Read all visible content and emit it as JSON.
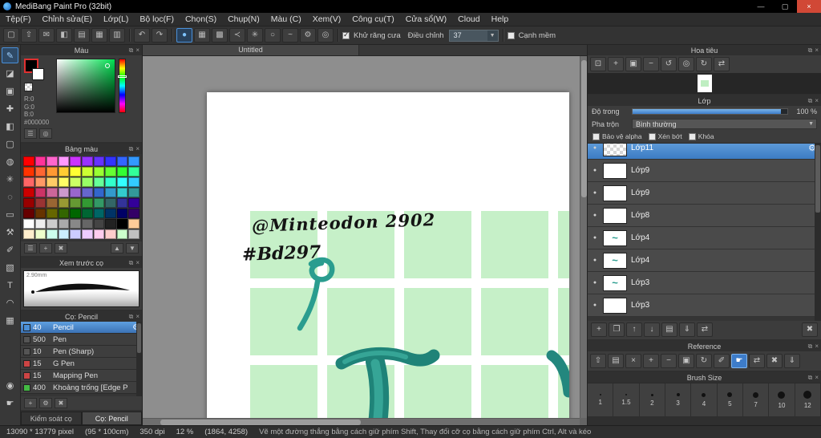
{
  "window": {
    "title": "MediBang Paint Pro (32bit)"
  },
  "titlebar_controls": {
    "minimize": "—",
    "maximize": "▢",
    "close": "×"
  },
  "menu": {
    "items": [
      {
        "key": "file",
        "label": "Tệp(F)"
      },
      {
        "key": "edit",
        "label": "Chỉnh sửa(E)"
      },
      {
        "key": "layer",
        "label": "Lớp(L)"
      },
      {
        "key": "filter",
        "label": "Bộ lọc(F)"
      },
      {
        "key": "select",
        "label": "Chọn(S)"
      },
      {
        "key": "snap",
        "label": "Chụp(N)"
      },
      {
        "key": "color",
        "label": "Màu (C)"
      },
      {
        "key": "view",
        "label": "Xem(V)"
      },
      {
        "key": "tool",
        "label": "Công cụ(T)"
      },
      {
        "key": "window",
        "label": "Cửa sổ(W)"
      },
      {
        "key": "cloud",
        "label": "Cloud"
      },
      {
        "key": "help",
        "label": "Help"
      }
    ]
  },
  "toolbar": {
    "file_icons": [
      {
        "name": "new-file-icon",
        "glyph": "▢"
      },
      {
        "name": "export-icon",
        "glyph": "⇧"
      },
      {
        "name": "comment-icon",
        "glyph": "✉"
      },
      {
        "name": "material-icon",
        "glyph": "◧"
      },
      {
        "name": "document-icon",
        "glyph": "▤"
      },
      {
        "name": "pixel-grid-icon",
        "glyph": "▦"
      },
      {
        "name": "table-icon",
        "glyph": "▥"
      }
    ],
    "history_icons": [
      {
        "name": "undo-icon",
        "glyph": "↶"
      },
      {
        "name": "redo-icon",
        "glyph": "↷"
      }
    ],
    "brush_option_icons": [
      {
        "name": "brush-tip-icon",
        "glyph": "●",
        "active": true
      },
      {
        "name": "pattern-icon",
        "glyph": "▦"
      },
      {
        "name": "mesh-icon",
        "glyph": "▩"
      },
      {
        "name": "snap-angle-icon",
        "glyph": "≺"
      },
      {
        "name": "snap-radial-icon",
        "glyph": "✳"
      },
      {
        "name": "snap-circle-icon",
        "glyph": "○"
      },
      {
        "name": "snap-curve-icon",
        "glyph": "~"
      },
      {
        "name": "snap-settings-icon",
        "glyph": "⚙"
      },
      {
        "name": "crosshair-icon",
        "glyph": "◎"
      }
    ],
    "antialias": {
      "label": "Khử răng cưa",
      "checked": true
    },
    "adjust": {
      "label": "Điều chỉnh",
      "value": "37"
    },
    "soft_edge": {
      "label": "Cạnh mềm",
      "checked": false
    }
  },
  "tools": {
    "items": [
      {
        "name": "brush-tool",
        "glyph": "✎",
        "active": true
      },
      {
        "name": "eraser-tool",
        "glyph": "◪"
      },
      {
        "name": "dot-tool",
        "glyph": "▣"
      },
      {
        "name": "move-tool",
        "glyph": "✚"
      },
      {
        "name": "fill-tool",
        "glyph": "◧"
      },
      {
        "name": "select-tool",
        "glyph": "▢"
      },
      {
        "name": "bucket-tool",
        "glyph": "◍"
      },
      {
        "name": "magic-wand-tool",
        "glyph": "✳"
      },
      {
        "name": "ellipse-select-tool",
        "glyph": "◌"
      },
      {
        "name": "rect-select-tool",
        "glyph": "▭"
      },
      {
        "name": "operation-tool",
        "glyph": "⚒"
      },
      {
        "name": "select-pen-tool",
        "glyph": "✐"
      },
      {
        "name": "gradient-tool",
        "glyph": "▧"
      },
      {
        "name": "text-tool",
        "glyph": "T"
      },
      {
        "name": "lasso-tool",
        "glyph": "◠"
      },
      {
        "name": "frame-divide-tool",
        "glyph": "▦"
      }
    ],
    "bottom": [
      {
        "name": "eyedropper-tool",
        "glyph": "◉"
      },
      {
        "name": "hand-tool",
        "glyph": "☛"
      }
    ]
  },
  "panels": {
    "color": {
      "title": "Màu",
      "r": "R:0",
      "g": "G:0",
      "b": "B:0",
      "hex": "#000000",
      "bottom_icons": [
        {
          "name": "color-sliders-icon",
          "glyph": "☰"
        },
        {
          "name": "color-wheel-icon",
          "glyph": "◎"
        }
      ]
    },
    "palette": {
      "title": "Bảng màu",
      "colors": [
        "#ff0000",
        "#ff3399",
        "#ff66cc",
        "#ff99ff",
        "#cc33ff",
        "#9933ff",
        "#6633ff",
        "#3333ff",
        "#3366ff",
        "#3399ff",
        "#ff3300",
        "#ff6633",
        "#ff9933",
        "#ffcc33",
        "#ffff33",
        "#ccff33",
        "#99ff33",
        "#66ff33",
        "#33ff33",
        "#33ff99",
        "#ff6666",
        "#ff9966",
        "#ffcc66",
        "#ffff66",
        "#ccff66",
        "#99ff66",
        "#66ff99",
        "#33ffcc",
        "#33ffff",
        "#33ccff",
        "#cc0000",
        "#cc3366",
        "#cc6699",
        "#cc99cc",
        "#9966cc",
        "#6666cc",
        "#3366cc",
        "#3399cc",
        "#33cccc",
        "#339999",
        "#990000",
        "#993333",
        "#996633",
        "#999933",
        "#669933",
        "#339933",
        "#339966",
        "#336666",
        "#333399",
        "#330099",
        "#660000",
        "#663300",
        "#666600",
        "#336600",
        "#006600",
        "#006633",
        "#006666",
        "#003366",
        "#000066",
        "#330066",
        "#ffffff",
        "#eeeeee",
        "#cccccc",
        "#aaaaaa",
        "#888888",
        "#666666",
        "#444444",
        "#222222",
        "#000000",
        "#ffcc99",
        "#ffeecc",
        "#eeffcc",
        "#ccffee",
        "#cceeff",
        "#ccccff",
        "#eeccff",
        "#ffccee",
        "#ffcccc",
        "#ccffcc",
        "#c0c0c0"
      ],
      "buttons": [
        {
          "name": "palette-list-icon",
          "glyph": "☰"
        },
        {
          "name": "add-color-icon",
          "glyph": "+"
        },
        {
          "name": "delete-color-icon",
          "glyph": "✖"
        }
      ],
      "sort_buttons": [
        {
          "name": "move-color-up-icon",
          "glyph": "▲"
        },
        {
          "name": "move-color-down-icon",
          "glyph": "▼"
        }
      ]
    },
    "preview": {
      "title": "Xem trước cọ",
      "size_label": "2.90mm"
    },
    "brushes": {
      "title": "Cọ: Pencil",
      "items": [
        {
          "size": "40",
          "name": "Pencil",
          "chip": "#4a90d9",
          "selected": true
        },
        {
          "size": "500",
          "name": "Pen",
          "chip": "#555555"
        },
        {
          "size": "10",
          "name": "Pen (Sharp)",
          "chip": "#555555"
        },
        {
          "size": "15",
          "name": "G Pen",
          "chip": "#cc4444"
        },
        {
          "size": "15",
          "name": "Mapping Pen",
          "chip": "#cc4444"
        },
        {
          "size": "400",
          "name": "Khoảng trống [Edge P",
          "chip": "#44bb44"
        }
      ],
      "buttons": [
        {
          "name": "add-brush-icon",
          "glyph": "+"
        },
        {
          "name": "brush-settings-icon",
          "glyph": "⚙"
        },
        {
          "name": "delete-brush-icon",
          "glyph": "✖"
        }
      ],
      "tabs": [
        "Kiểm soát cọ",
        "Cọ: Pencil"
      ]
    },
    "navigator": {
      "title": "Hoa tiêu",
      "icons": [
        {
          "name": "fit-view-icon",
          "glyph": "⊡"
        },
        {
          "name": "zoom-in-icon",
          "glyph": "+"
        },
        {
          "name": "zoom-panel-icon",
          "glyph": "▣"
        },
        {
          "name": "zoom-out-icon",
          "glyph": "−"
        },
        {
          "name": "rotate-left-icon",
          "glyph": "↺"
        },
        {
          "name": "reset-view-icon",
          "glyph": "◎"
        },
        {
          "name": "rotate-right-icon",
          "glyph": "↻"
        },
        {
          "name": "flip-view-icon",
          "glyph": "⇄"
        }
      ]
    },
    "layers": {
      "title": "Lớp",
      "opacity_label": "Độ trong",
      "opacity_value": "100 %",
      "blend_label": "Pha trộn",
      "blend_value": "Bình thường",
      "checkboxes": [
        "Bảo vệ alpha",
        "Xén bớt",
        "Khóa"
      ],
      "items": [
        {
          "name": "Lớp11",
          "selected": true,
          "thumb": "checker"
        },
        {
          "name": "Lớp9",
          "thumb": "plain"
        },
        {
          "name": "Lớp9",
          "thumb": "plain"
        },
        {
          "name": "Lớp8",
          "thumb": "plain"
        },
        {
          "name": "Lớp4",
          "thumb": "teal"
        },
        {
          "name": "Lớp4",
          "thumb": "teal"
        },
        {
          "name": "Lớp3",
          "thumb": "teal"
        },
        {
          "name": "Lớp3",
          "thumb": "plain"
        }
      ],
      "toolbar_icons": [
        {
          "name": "add-layer-icon",
          "glyph": "+"
        },
        {
          "name": "duplicate-layer-icon",
          "glyph": "❐"
        },
        {
          "name": "layer-up-icon",
          "glyph": "↑"
        },
        {
          "name": "layer-down-icon",
          "glyph": "↓"
        },
        {
          "name": "new-folder-icon",
          "glyph": "▤"
        },
        {
          "name": "merge-down-icon",
          "glyph": "⇓"
        },
        {
          "name": "transfer-layer-icon",
          "glyph": "⇄"
        }
      ],
      "delete_icon": {
        "name": "delete-layer-icon",
        "glyph": "✖"
      }
    },
    "reference": {
      "title": "Reference",
      "icons": [
        {
          "name": "open-reference-icon",
          "glyph": "⇧"
        },
        {
          "name": "folder-icon",
          "glyph": "▤"
        },
        {
          "name": "close-reference-icon",
          "glyph": "×"
        },
        {
          "name": "zoom-in-icon",
          "glyph": "+"
        },
        {
          "name": "zoom-out-icon",
          "glyph": "−"
        },
        {
          "name": "actual-size-icon",
          "glyph": "▣"
        },
        {
          "name": "rotate-icon",
          "glyph": "↻"
        },
        {
          "name": "eyedropper-icon",
          "glyph": "✐"
        },
        {
          "name": "hand-icon",
          "glyph": "☛",
          "active": true
        },
        {
          "name": "flip-icon",
          "glyph": "⇄"
        },
        {
          "name": "clear-icon",
          "glyph": "✖"
        },
        {
          "name": "save-icon",
          "glyph": "⇓"
        }
      ]
    },
    "brush_size": {
      "title": "Brush Size",
      "sizes": [
        {
          "label": "1",
          "dot": 2
        },
        {
          "label": "1.5",
          "dot": 2
        },
        {
          "label": "2",
          "dot": 3
        },
        {
          "label": "3",
          "dot": 4
        },
        {
          "label": "4",
          "dot": 5
        },
        {
          "label": "5",
          "dot": 6
        },
        {
          "label": "7",
          "dot": 7
        },
        {
          "label": "10",
          "dot": 9
        },
        {
          "label": "12",
          "dot": 10
        }
      ]
    }
  },
  "canvas": {
    "tab": "Untitled",
    "handwriting_line1": "@Minteodon 2902",
    "handwriting_line2": "#Bd297",
    "grid": {
      "cols": 5,
      "rows": 3,
      "size": 84,
      "step": 96,
      "ox": 54,
      "oy": 148,
      "color": "#c6f0c8"
    },
    "ink_color": "#1f8378",
    "ink_light": "#36a596"
  },
  "status": {
    "items": [
      {
        "name": "canvas-size",
        "text": "13090 * 13779 pixel"
      },
      {
        "name": "canvas-size-cm",
        "text": "(95 * 100cm)"
      },
      {
        "name": "dpi",
        "text": "350 dpi"
      },
      {
        "name": "zoom-level",
        "text": "12 %"
      },
      {
        "name": "cursor-position",
        "text": "(1864, 4258)"
      }
    ],
    "hint": "Vẽ một đường thẳng bằng cách giữ phím Shift, Thay đổi cỡ cọ bằng cách giữ phím Ctrl, Alt và kéo"
  }
}
